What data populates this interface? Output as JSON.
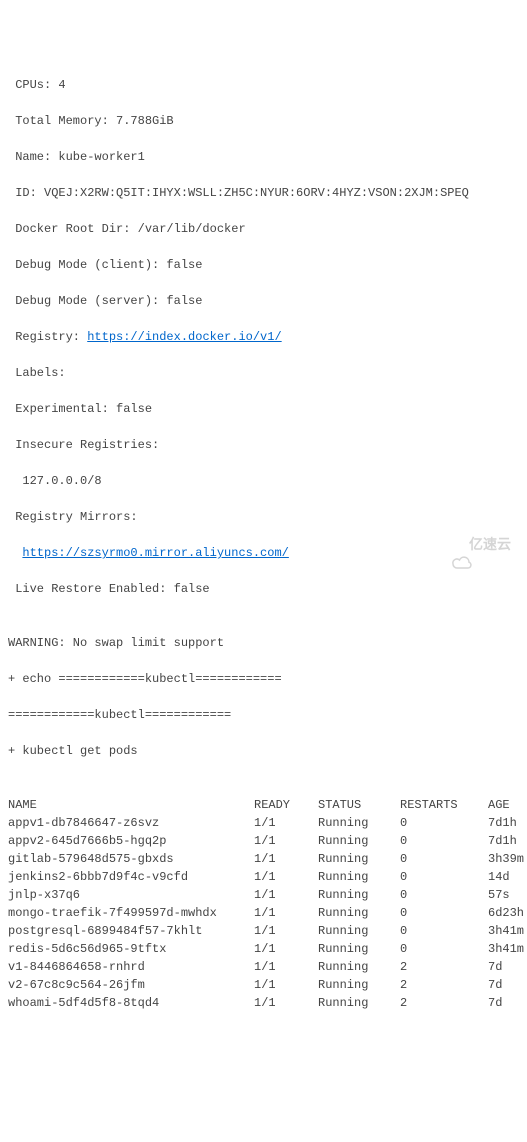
{
  "info": {
    "cpus_label": " CPUs: 4",
    "mem_label": " Total Memory: 7.788GiB",
    "name_label": " Name: kube-worker1",
    "id_label": " ID: VQEJ:X2RW:Q5IT:IHYX:WSLL:ZH5C:NYUR:6ORV:4HYZ:VSON:2XJM:SPEQ",
    "docker_root": " Docker Root Dir: /var/lib/docker",
    "debug_client": " Debug Mode (client): false",
    "debug_server": " Debug Mode (server): false",
    "registry_label": " Registry: ",
    "registry_url": "https://index.docker.io/v1/",
    "labels_label": " Labels:",
    "experimental": " Experimental: false",
    "insecure": " Insecure Registries:",
    "insecure_val": "  127.0.0.0/8",
    "mirrors_label": " Registry Mirrors:",
    "mirror_indent": "  ",
    "mirror_url": "https://szsyrmo0.mirror.aliyuncs.com/",
    "live_restore": " Live Restore Enabled: false",
    "blank": "",
    "warning": "WARNING: No swap limit support",
    "echo_line": "+ echo ============kubectl============",
    "sep_line": "============kubectl============",
    "cmd_line": "+ kubectl get pods"
  },
  "headers": {
    "name": "NAME",
    "ready": "READY",
    "status": "STATUS",
    "restarts": "RESTARTS",
    "age": "AGE"
  },
  "pods": [
    {
      "name": "appv1-db7846647-z6svz",
      "ready": "1/1",
      "status": "Running",
      "restarts": "0",
      "age": "7d1h"
    },
    {
      "name": "appv2-645d7666b5-hgq2p",
      "ready": "1/1",
      "status": "Running",
      "restarts": "0",
      "age": "7d1h"
    },
    {
      "name": "gitlab-579648d575-gbxds",
      "ready": "1/1",
      "status": "Running",
      "restarts": "0",
      "age": "3h39m"
    },
    {
      "name": "jenkins2-6bbb7d9f4c-v9cfd",
      "ready": "1/1",
      "status": "Running",
      "restarts": "0",
      "age": "14d"
    },
    {
      "name": "jnlp-x37q6",
      "ready": "1/1",
      "status": "Running",
      "restarts": "0",
      "age": "57s"
    },
    {
      "name": "mongo-traefik-7f499597d-mwhdx",
      "ready": "1/1",
      "status": "Running",
      "restarts": "0",
      "age": "6d23h"
    },
    {
      "name": "postgresql-6899484f57-7khlt",
      "ready": "1/1",
      "status": "Running",
      "restarts": "0",
      "age": "3h41m"
    },
    {
      "name": "redis-5d6c56d965-9tftx",
      "ready": "1/1",
      "status": "Running",
      "restarts": "0",
      "age": "3h41m"
    },
    {
      "name": "v1-8446864658-rnhrd",
      "ready": "1/1",
      "status": "Running",
      "restarts": "2",
      "age": "7d"
    },
    {
      "name": "v2-67c8c9c564-26jfm",
      "ready": "1/1",
      "status": "Running",
      "restarts": "2",
      "age": "7d"
    },
    {
      "name": "whoami-5df4d5f8-8tqd4",
      "ready": "1/1",
      "status": "Running",
      "restarts": "2",
      "age": "7d"
    }
  ],
  "watermark": {
    "text": "亿速云"
  }
}
